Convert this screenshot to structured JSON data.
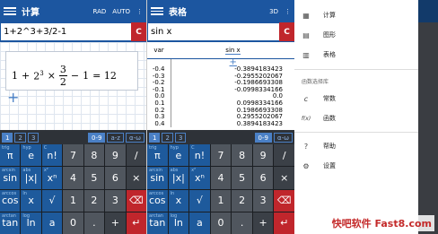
{
  "calc_panel": {
    "title": "计算",
    "mode_rad": "RAD",
    "mode_auto": "AUTO",
    "input": "1+2^3+3/2-1",
    "clear": "C",
    "expr": {
      "a": "1",
      "b": "2",
      "exp": "3",
      "num": "3",
      "den": "2",
      "c": "1",
      "result": "= 12"
    },
    "add": "+",
    "tabs": [
      "1",
      "2",
      "3",
      "0-9",
      "a-z",
      "α-ω"
    ]
  },
  "table_panel": {
    "title": "表格",
    "view_3d": "3D",
    "input": "sin x",
    "clear": "C",
    "col_var": "var",
    "col_fn": "sin x",
    "add_col": "+",
    "rows": [
      [
        "-0.4",
        "-0.3894183423"
      ],
      [
        "-0.3",
        "-0.2955202067"
      ],
      [
        "-0.2",
        "-0.1986693308"
      ],
      [
        "-0.1",
        "-0.0998334166"
      ],
      [
        "0.0",
        "0.0"
      ],
      [
        "0.1",
        "0.0998334166"
      ],
      [
        "0.2",
        "0.1986693308"
      ],
      [
        "0.3",
        "0.2955202067"
      ],
      [
        "0.4",
        "0.3894183423"
      ]
    ],
    "tabs": [
      "1",
      "2",
      "3",
      "0-9",
      "α-ω"
    ]
  },
  "keypad": {
    "row1": [
      [
        "π",
        "trig"
      ],
      [
        "e",
        "hyp"
      ],
      [
        "n!",
        "C"
      ],
      [
        "7",
        ""
      ],
      [
        "8",
        ""
      ],
      [
        "9",
        ""
      ],
      [
        "/",
        ""
      ]
    ],
    "row2": [
      [
        "sin",
        "arcsin"
      ],
      [
        "|x|",
        "abs"
      ],
      [
        "xⁿ",
        "x²"
      ],
      [
        "4",
        ""
      ],
      [
        "5",
        ""
      ],
      [
        "6",
        ""
      ],
      [
        "×",
        ""
      ]
    ],
    "row3": [
      [
        "cos",
        "arccos"
      ],
      [
        "x",
        "ln"
      ],
      [
        "√",
        ""
      ],
      [
        "1",
        ""
      ],
      [
        "2",
        ""
      ],
      [
        "3",
        ""
      ],
      [
        "⌫",
        ""
      ]
    ],
    "row4": [
      [
        "tan",
        "arctan"
      ],
      [
        "ln",
        "log"
      ],
      [
        "a",
        ""
      ],
      [
        "0",
        ""
      ],
      [
        ".",
        ""
      ],
      [
        "+",
        ""
      ],
      [
        "↵",
        ""
      ]
    ],
    "extra": [
      "(",
      ")",
      "−"
    ]
  },
  "drawer": {
    "items": [
      {
        "label": "计算",
        "icon": "calculator-icon"
      },
      {
        "label": "图形",
        "icon": "graph-icon"
      },
      {
        "label": "表格",
        "icon": "table-icon"
      }
    ],
    "section": "函数选择库",
    "lib": [
      {
        "label": "常数",
        "icon": "c-icon"
      },
      {
        "label": "函数",
        "icon": "fx-icon"
      }
    ],
    "footer": [
      {
        "label": "帮助",
        "icon": "help-icon"
      },
      {
        "label": "设置",
        "icon": "gear-icon"
      }
    ]
  },
  "watermark": "快吧软件 Fast8.com",
  "colors": {
    "appbar": "#1c56a0",
    "accent": "#c0262c",
    "fn_key": "#1e5a9c"
  }
}
